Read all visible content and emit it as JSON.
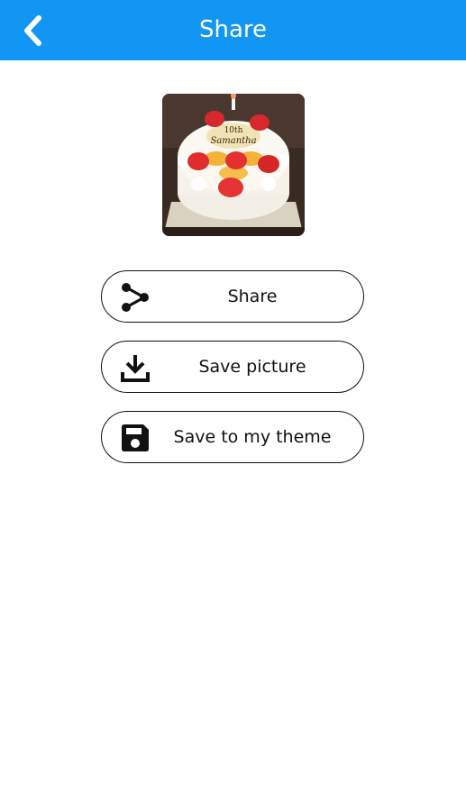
{
  "header": {
    "title": "Share",
    "back_icon": "chevron-left-icon",
    "background_color": "#1196f3"
  },
  "preview": {
    "cake_text": "Samantha",
    "cake_number": "10th"
  },
  "actions": [
    {
      "label": "Share",
      "icon": "share-icon"
    },
    {
      "label": "Save picture",
      "icon": "download-icon"
    },
    {
      "label": "Save to my theme",
      "icon": "save-disk-icon"
    }
  ]
}
